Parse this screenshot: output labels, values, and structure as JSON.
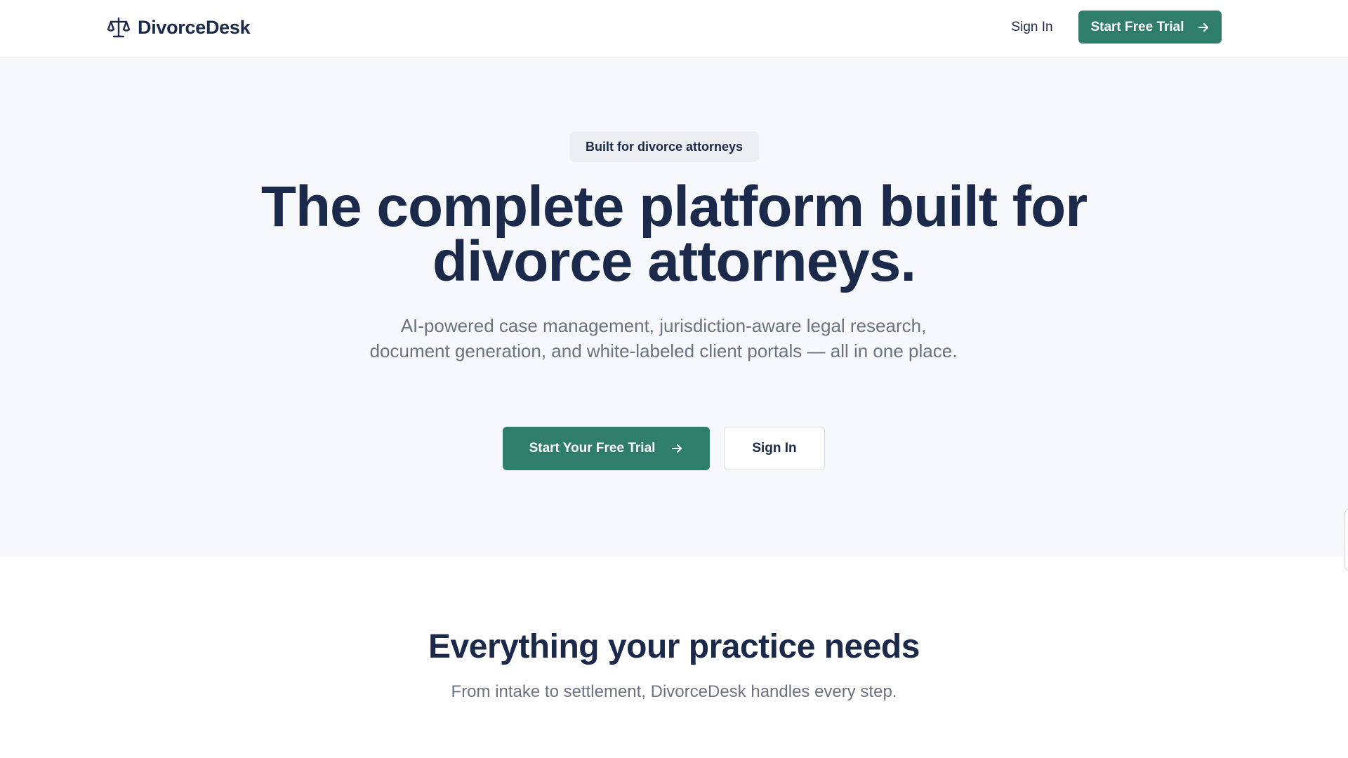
{
  "header": {
    "brand_name": "DivorceDesk",
    "brand_icon": "scales-icon",
    "signin_label": "Sign In",
    "trial_label": "Start Free Trial"
  },
  "hero": {
    "badge": "Built for divorce attorneys",
    "headline": "The complete platform built for divorce attorneys.",
    "subtext": "AI-powered case management, jurisdiction-aware legal research, document generation, and white-labeled client portals — all in one place.",
    "primary_cta": "Start Your Free Trial",
    "secondary_cta": "Sign In"
  },
  "features": {
    "title": "Everything your practice needs",
    "subtitle": "From intake to settlement, DivorceDesk handles every step."
  },
  "colors": {
    "brand_green": "#2f7d6b",
    "navy_text": "#1b2a4a",
    "muted_text": "#6b7280",
    "hero_bg": "#f7f8fb"
  }
}
